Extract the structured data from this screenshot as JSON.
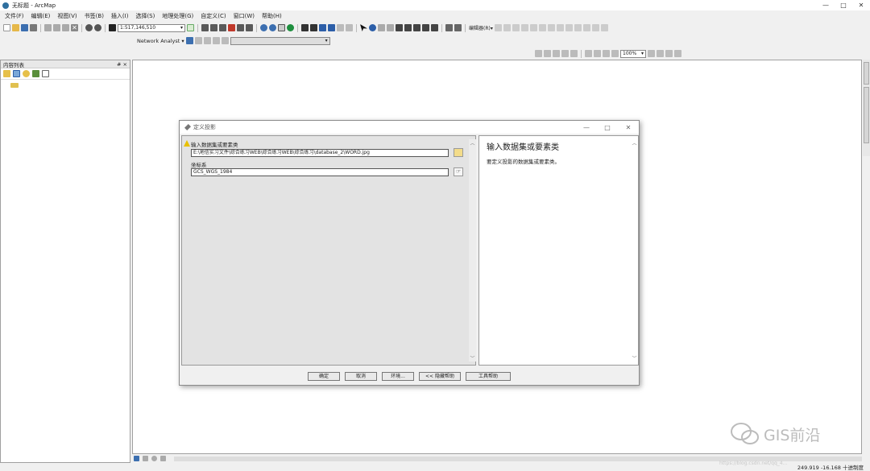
{
  "window": {
    "title": "无标题 - ArcMap",
    "controls": [
      "—",
      "□",
      "✕"
    ]
  },
  "menu": [
    "文件(F)",
    "编辑(E)",
    "视图(V)",
    "书签(B)",
    "插入(I)",
    "选择(S)",
    "地理处理(G)",
    "自定义(C)",
    "窗口(W)",
    "帮助(H)"
  ],
  "toolbar": {
    "scale": "1:517,146,510",
    "network_analyst": "Network Analyst ▾",
    "georef_label": "编辑器(R)▾",
    "zoom_percent": "100%"
  },
  "toc": {
    "title": "内容列表",
    "pin": "# ×"
  },
  "dialog": {
    "title": "定义投影",
    "controls": [
      "—",
      "□",
      "✕"
    ],
    "input_label": "输入数据集或要素类",
    "input_value": "E:\\地信实习文件\\综合练习WEB\\综合练习WEB\\综合练习\\database_2\\WORD.jpg",
    "coord_label": "坐标系",
    "coord_value": "GCS_WGS_1984",
    "help_title": "输入数据集或要素类",
    "help_text": "要定义投影的数据集或要素类。",
    "buttons": {
      "ok": "确定",
      "cancel": "取消",
      "env": "环境...",
      "hide_help": "<< 隐藏帮助",
      "tool_help": "工具帮助"
    }
  },
  "status": {
    "coords": "249.919  -16.168 十进制度"
  },
  "watermark": {
    "text": "GIS前沿",
    "url": "https://blog.csdn.net/qq_4..."
  },
  "colors": {
    "accent": "#2f6f9f",
    "warning": "#e8c000"
  }
}
